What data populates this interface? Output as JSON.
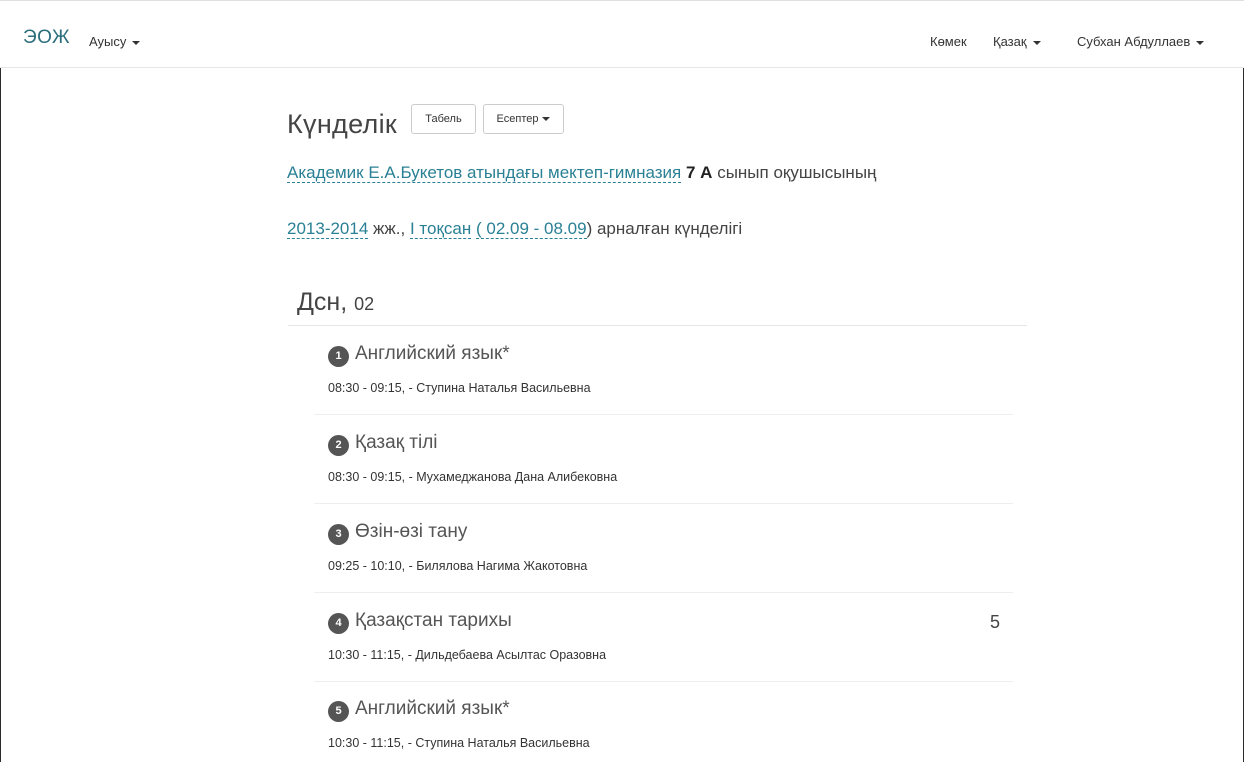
{
  "navbar": {
    "brand": "ЭОЖ",
    "switch_label": "Ауысу",
    "help_label": "Көмек",
    "lang_label": "Қазақ",
    "user_label": "Субхан Абдуллаев"
  },
  "diary": {
    "title": "Күнделік",
    "tabel_button": "Табель",
    "reports_button": "Есептер"
  },
  "info": {
    "school": "Академик Е.А.Букетов атындағы мектеп-гимназия",
    "class": "7 А",
    "class_suffix": "сынып оқушысының",
    "year": "2013-2014",
    "year_suffix": "жж.,",
    "quarter": "I тоқсан",
    "range": "( 02.09 - 08.09",
    "range_suffix": ") арналған күнделігі"
  },
  "day": {
    "name": "Дсн,",
    "number": "02"
  },
  "lessons": [
    {
      "num": "1",
      "subject": "Английский язык*",
      "meta": "08:30 - 09:15, - Ступина Наталья Васильевна",
      "grade": ""
    },
    {
      "num": "2",
      "subject": "Қазақ тілі",
      "meta": "08:30 - 09:15, - Мухамеджанова Дана Алибековна",
      "grade": ""
    },
    {
      "num": "3",
      "subject": "Өзін-өзі тану",
      "meta": "09:25 - 10:10, - Билялова Нагима Жакотовна",
      "grade": ""
    },
    {
      "num": "4",
      "subject": "Қазақстан тарихы",
      "meta": "10:30 - 11:15, - Дильдебаева Асылтас Оразовна",
      "grade": "5"
    },
    {
      "num": "5",
      "subject": "Английский язык*",
      "meta": "10:30 - 11:15, - Ступина Наталья Васильевна",
      "grade": ""
    }
  ]
}
